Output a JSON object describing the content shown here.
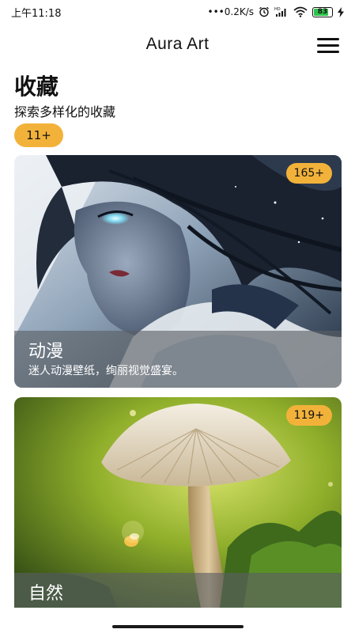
{
  "status_bar": {
    "time": "上午11:18",
    "network_speed": "0.2K/s",
    "hd_label": "HD",
    "battery_level": "83",
    "battery_fraction": 0.83,
    "icons": [
      "alarm-icon",
      "wifi-icon",
      "battery-icon",
      "charging-icon"
    ]
  },
  "header": {
    "title": "Aura Art",
    "menu_icon": "hamburger-menu-icon"
  },
  "collection": {
    "title": "收藏",
    "subtitle": "探索多样化的收藏",
    "count": "11+"
  },
  "cards": [
    {
      "title": "动漫",
      "description": "迷人动漫壁纸，绚丽视觉盛宴。",
      "count": "165+"
    },
    {
      "title": "自然",
      "description": "",
      "count": "119+"
    }
  ],
  "colors": {
    "accent": "#f2b23a",
    "overlay": "#5a5f64",
    "battery_green": "#2ec24a"
  }
}
